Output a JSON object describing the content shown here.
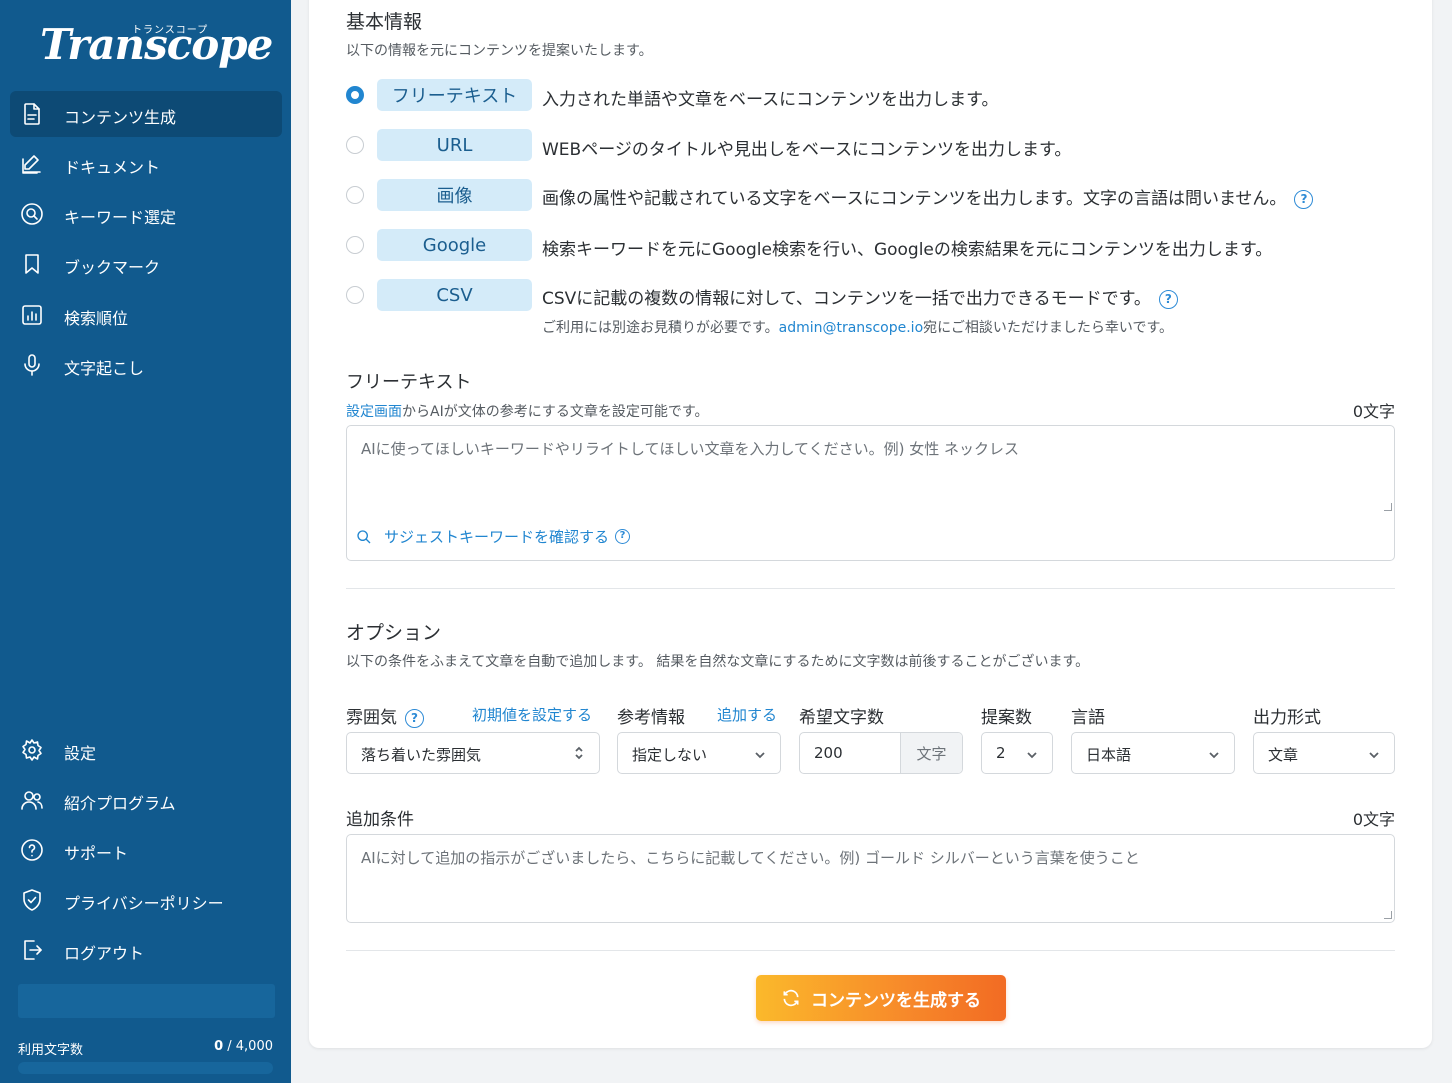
{
  "brand": {
    "logo_text": "Transcope",
    "logo_kana": "トランスコープ"
  },
  "sidebar": {
    "items": [
      {
        "label": "コンテンツ生成",
        "icon": "document-icon",
        "active": true
      },
      {
        "label": "ドキュメント",
        "icon": "edit-icon"
      },
      {
        "label": "キーワード選定",
        "icon": "search-circle-icon"
      },
      {
        "label": "ブックマーク",
        "icon": "bookmark-icon"
      },
      {
        "label": "検索順位",
        "icon": "bar-chart-icon"
      },
      {
        "label": "文字起こし",
        "icon": "microphone-icon"
      }
    ],
    "bottom_items": [
      {
        "label": "設定",
        "icon": "gear-icon"
      },
      {
        "label": "紹介プログラム",
        "icon": "users-icon"
      },
      {
        "label": "サポート",
        "icon": "help-icon"
      },
      {
        "label": "プライバシーポリシー",
        "icon": "shield-icon"
      },
      {
        "label": "ログアウト",
        "icon": "logout-icon"
      }
    ],
    "usage": {
      "label": "利用文字数",
      "used": "0",
      "total": "/ 4,000",
      "fraction": 0
    }
  },
  "basic": {
    "title": "基本情報",
    "desc": "以下の情報を元にコンテンツを提案いたします。",
    "modes": [
      {
        "tag": "フリーテキスト",
        "desc": "入力された単語や文章をベースにコンテンツを出力します。",
        "checked": true
      },
      {
        "tag": "URL",
        "desc": "WEBページのタイトルや見出しをベースにコンテンツを出力します。"
      },
      {
        "tag": "画像",
        "desc": "画像の属性や記載されている文字をベースにコンテンツを出力します。文字の言語は問いません。"
      },
      {
        "tag": "Google",
        "desc": "検索キーワードを元にGoogle検索を行い、Googleの検索結果を元にコンテンツを出力します。"
      },
      {
        "tag": "CSV",
        "desc": "CSVに記載の複数の情報に対して、コンテンツを一括で出力できるモードです。"
      }
    ],
    "csv_note_pre": "ご利用には別途お見積りが必要です。",
    "csv_note_email": "admin@transcope.io",
    "csv_note_post": "宛にご相談いただけましたら幸いです。"
  },
  "freetext": {
    "title": "フリーテキスト",
    "desc_link": "設定画面",
    "desc_rest": "からAIが文体の参考にする文章を設定可能です。",
    "count": "0文字",
    "placeholder": "AIに使ってほしいキーワードやリライトしてほしい文章を入力してください。例) 女性 ネックレス",
    "suggest": "サジェストキーワードを確認する"
  },
  "options": {
    "title": "オプション",
    "desc": "以下の条件をふまえて文章を自動で追加します。 結果を自然な文章にするために文字数は前後することがございます。",
    "mood_label": "雰囲気",
    "mood_default_link": "初期値を設定する",
    "mood_value": "落ち着いた雰囲気",
    "ref_label": "参考情報",
    "ref_add_link": "追加する",
    "ref_value": "指定しない",
    "length_label": "希望文字数",
    "length_value": "200",
    "length_unit": "文字",
    "count_label": "提案数",
    "count_value": "2",
    "lang_label": "言語",
    "lang_value": "日本語",
    "format_label": "出力形式",
    "format_value": "文章",
    "extra_label": "追加条件",
    "extra_count": "0文字",
    "extra_placeholder": "AIに対して追加の指示がございましたら、こちらに記載してください。例) ゴールド シルバーという言葉を使うこと"
  },
  "generate_button": "コンテンツを生成する",
  "colors": {
    "sidebar": "#115a8e",
    "accent": "#2186d0",
    "tag_bg": "#d4ebf9",
    "cta_start": "#fbb92b",
    "cta_end": "#f26b23"
  }
}
